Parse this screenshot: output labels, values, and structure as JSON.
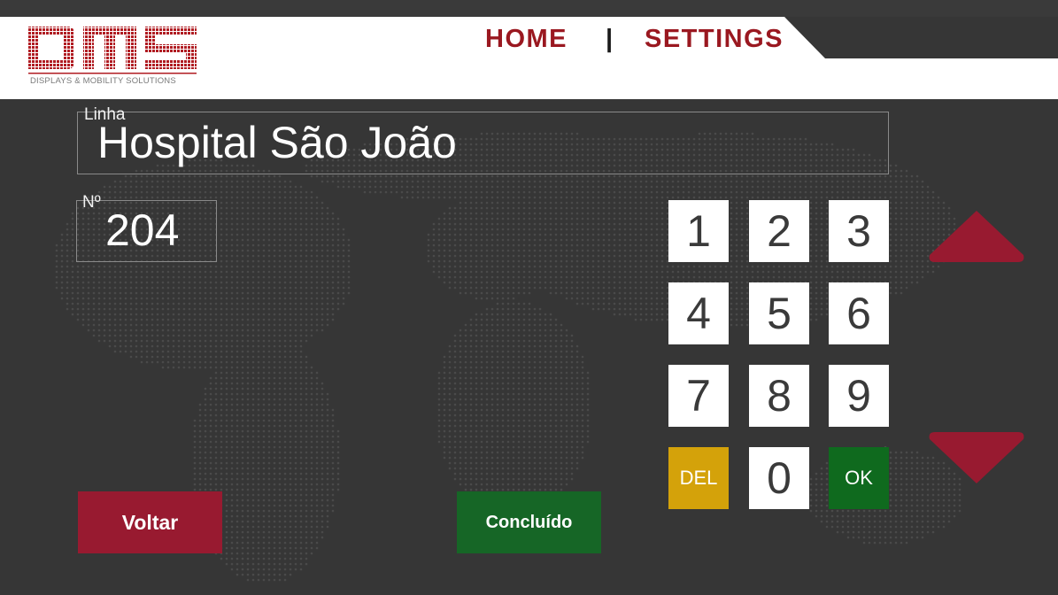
{
  "header": {
    "logo_text": "DMS",
    "logo_subtitle": "DISPLAYS & MOBILITY SOLUTIONS",
    "nav_home": "HOME",
    "nav_separator": "|",
    "nav_settings": "SETTINGS"
  },
  "form": {
    "linha_label": "Linha",
    "linha_value": "Hospital  São João",
    "numero_label": "Nº",
    "numero_value": "204"
  },
  "keypad": {
    "keys": [
      "1",
      "2",
      "3",
      "4",
      "5",
      "6",
      "7",
      "8",
      "9",
      "DEL",
      "0",
      "OK"
    ]
  },
  "buttons": {
    "back_label": "Voltar",
    "done_label": "Concluído"
  },
  "icons": {
    "up": "arrow-up-icon",
    "down": "arrow-down-icon"
  },
  "colors": {
    "brand_red": "#9a1820",
    "del_yellow": "#d4a20a",
    "ok_green": "#0f6a1e",
    "back_red": "#981a30",
    "done_green": "#166626",
    "arrow_red": "#981a30"
  }
}
